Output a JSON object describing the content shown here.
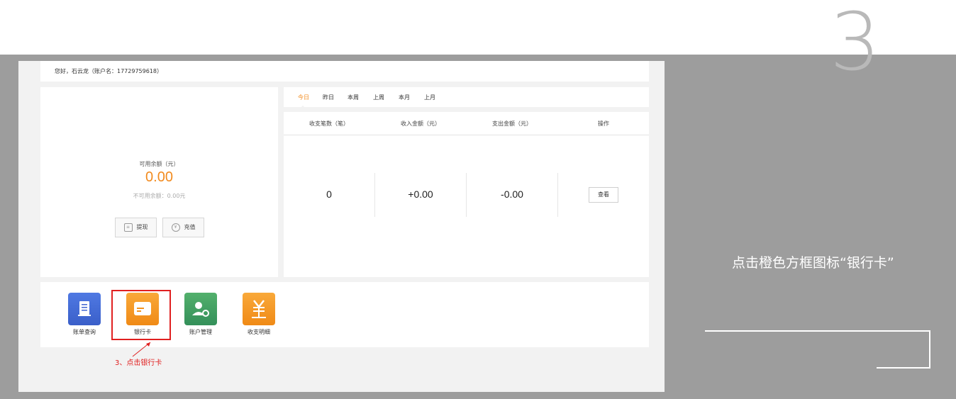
{
  "step_number": "3",
  "instruction": "点击橙色方框图标“银行卡”",
  "greeting": "您好，石云龙（账户名：17729759618）",
  "balance": {
    "label": "可用余额（元）",
    "value": "0.00",
    "unavailable": "不可用余额：0.00元",
    "withdraw_label": "提现",
    "recharge_label": "充值"
  },
  "tabs": [
    "今日",
    "昨日",
    "本周",
    "上周",
    "本月",
    "上月"
  ],
  "active_tab": "今日",
  "stats": {
    "headers": [
      "收支笔数（笔）",
      "收入金额（元）",
      "支出金额（元）",
      "操作"
    ],
    "count": "0",
    "income": "+0.00",
    "expense": "-0.00",
    "view_label": "查看"
  },
  "shortcuts": [
    {
      "label": "账单查询",
      "icon": "bill-icon",
      "color": "#3f66d1"
    },
    {
      "label": "银行卡",
      "icon": "bank-card-icon",
      "color": "#f3931f"
    },
    {
      "label": "账户管理",
      "icon": "account-manage-icon",
      "color": "#3d9a5f"
    },
    {
      "label": "收支明细",
      "icon": "yuan-detail-icon",
      "color": "#f3931f"
    }
  ],
  "annotation": "3、点击银行卡",
  "colors": {
    "accent": "#f28b1f",
    "highlight": "#e02020",
    "background": "#9d9d9d"
  }
}
